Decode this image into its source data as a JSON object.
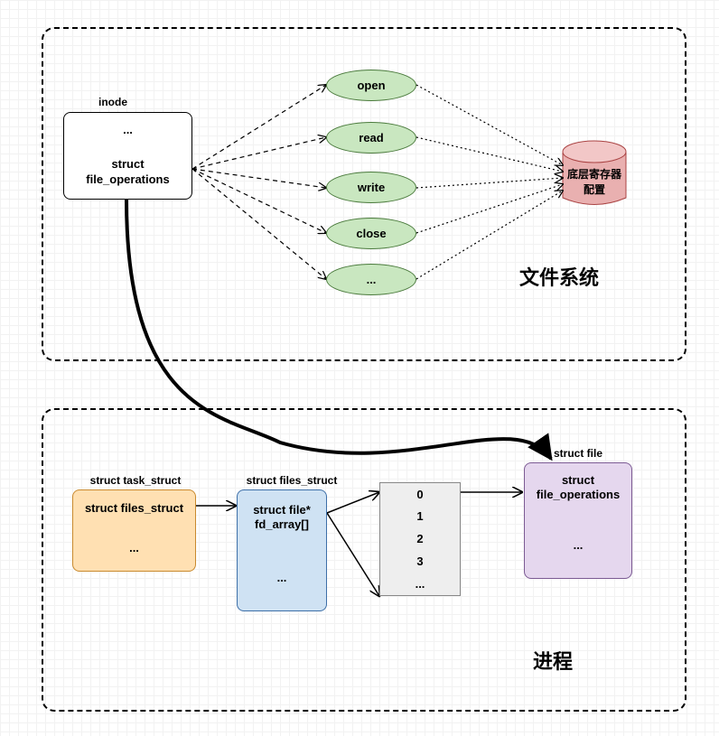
{
  "filesystem": {
    "group_title": "文件系统",
    "inode": {
      "title": "inode",
      "row1": "...",
      "row2": "struct\nfile_operations"
    },
    "ops": [
      "open",
      "read",
      "write",
      "close",
      "..."
    ],
    "register": "底层寄存器配置"
  },
  "process": {
    "group_title": "进程",
    "task_struct": {
      "title": "struct task_struct",
      "row1": "struct files_struct",
      "row2": "..."
    },
    "files_struct": {
      "title": "struct files_struct",
      "row1": "struct file*\nfd_array[]",
      "row2": "..."
    },
    "fd_array": [
      "0",
      "1",
      "2",
      "3",
      "..."
    ],
    "struct_file": {
      "title": "struct file",
      "row1": "struct\nfile_operations",
      "row2": "..."
    }
  }
}
